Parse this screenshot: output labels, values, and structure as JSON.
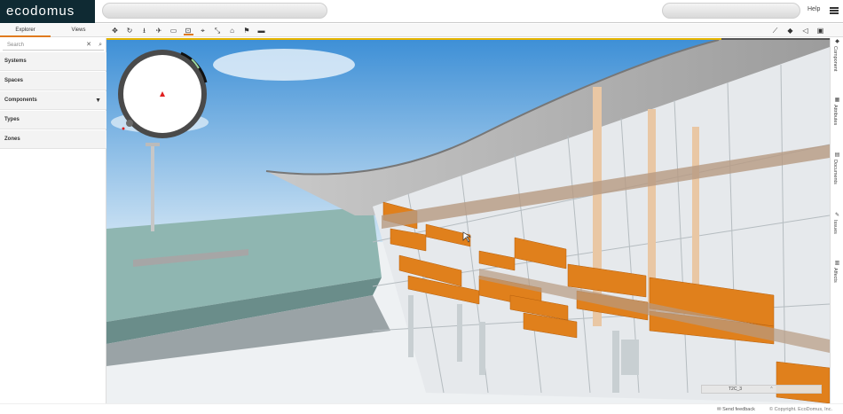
{
  "brand": {
    "logo_text": "ecodomus"
  },
  "header": {
    "help_label": "Help"
  },
  "explorer": {
    "tabs": [
      {
        "label": "Explorer"
      },
      {
        "label": "Views"
      }
    ],
    "search_placeholder": "Search",
    "items": [
      {
        "label": "Systems"
      },
      {
        "label": "Spaces"
      },
      {
        "label": "Components"
      },
      {
        "label": "Types"
      },
      {
        "label": "Zones"
      }
    ]
  },
  "toolbar": {
    "tools": [
      {
        "icon": "move-icon",
        "glyph": "✥"
      },
      {
        "icon": "orbit-icon",
        "glyph": "↻"
      },
      {
        "icon": "walk-icon",
        "glyph": "⭳"
      },
      {
        "icon": "fly-icon",
        "glyph": "✈"
      },
      {
        "icon": "section-box-icon",
        "glyph": "▭"
      },
      {
        "icon": "measure-icon",
        "glyph": "⊡"
      },
      {
        "icon": "target-icon",
        "glyph": "⌖"
      },
      {
        "icon": "path-icon",
        "glyph": "⤡"
      },
      {
        "icon": "home-icon",
        "glyph": "⌂"
      },
      {
        "icon": "tag-icon",
        "glyph": "⚑"
      },
      {
        "icon": "ruler-icon",
        "glyph": "▬"
      }
    ],
    "selected_index": 5,
    "right_tools": [
      {
        "icon": "chart-icon",
        "glyph": "⟋"
      },
      {
        "icon": "layers-icon",
        "glyph": "◆"
      },
      {
        "icon": "audio-icon",
        "glyph": "◁"
      },
      {
        "icon": "panel-icon",
        "glyph": "▣"
      }
    ]
  },
  "viewport": {
    "load_progress": 0.85,
    "level_label": "T2C_3"
  },
  "right_panel": {
    "tabs": [
      {
        "label": "Component",
        "icon": "component-icon"
      },
      {
        "label": "Attributes",
        "icon": "attributes-icon"
      },
      {
        "label": "Documents",
        "icon": "documents-icon"
      },
      {
        "label": "Issues",
        "icon": "issues-icon"
      },
      {
        "label": "Affects",
        "icon": "affects-icon"
      }
    ]
  },
  "footer": {
    "feedback_label": "Send feedback",
    "copyright": "© Copyright. EcoDomus, Inc."
  },
  "colors": {
    "accent": "#e07a1e",
    "brand_bg": "#0f2a33",
    "panel_orange": "#e0801c",
    "progress": "#e5b400"
  }
}
